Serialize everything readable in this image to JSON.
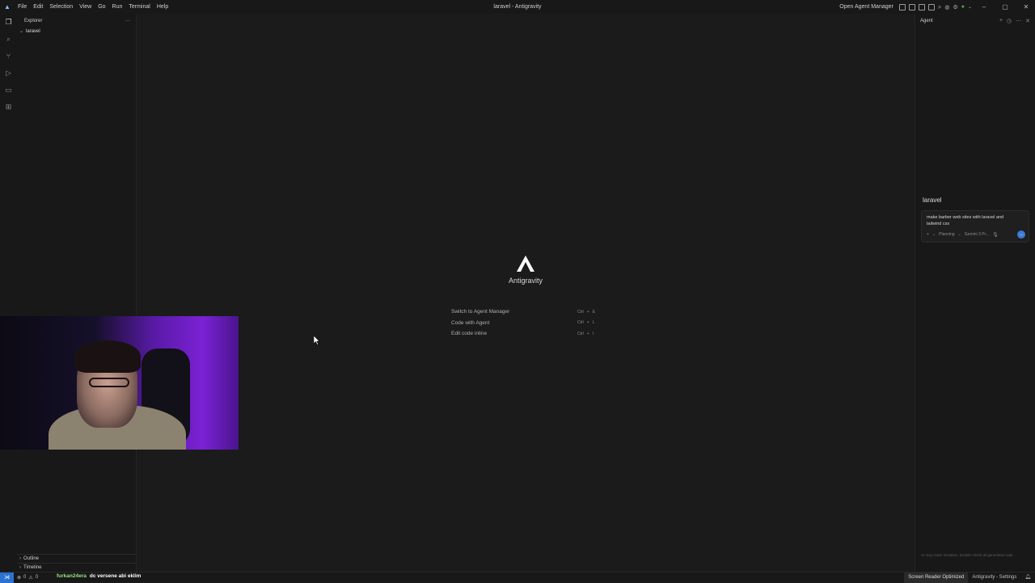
{
  "titlebar": {
    "menu": [
      "File",
      "Edit",
      "Selection",
      "View",
      "Go",
      "Run",
      "Terminal",
      "Help"
    ],
    "window_title": "laravel - Antigravity",
    "open_agent_manager": "Open Agent Manager"
  },
  "sidebar": {
    "title": "Explorer",
    "more": "···",
    "folder": "laravel",
    "outline": "Outline",
    "timeline": "Timeline"
  },
  "welcome": {
    "app_name": "Antigravity",
    "shortcuts": [
      {
        "label": "Switch to Agent Manager",
        "keys": [
          "Ctrl",
          "+",
          "E"
        ]
      },
      {
        "label": "Code with Agent",
        "keys": [
          "Ctrl",
          "+",
          "L"
        ]
      },
      {
        "label": "Edit code inline",
        "keys": [
          "Ctrl",
          "+",
          "I"
        ]
      }
    ]
  },
  "agent": {
    "title": "Agent",
    "workspace": "laravel",
    "prompt": "make barber web sites with laravel and tailwind css",
    "add": "+",
    "mode": "Planning",
    "model": "Gemini 3 Pr...",
    "disclaimer": "AI may make mistakes. Double-check all generated code."
  },
  "statusbar": {
    "problems_errors": "0",
    "problems_warnings": "0",
    "screen_reader": "Screen Reader Optimized",
    "settings": "Antigravity - Settings"
  },
  "chat_overlay": {
    "user": "furkan24era",
    "message": "dc versene abi eklim"
  }
}
